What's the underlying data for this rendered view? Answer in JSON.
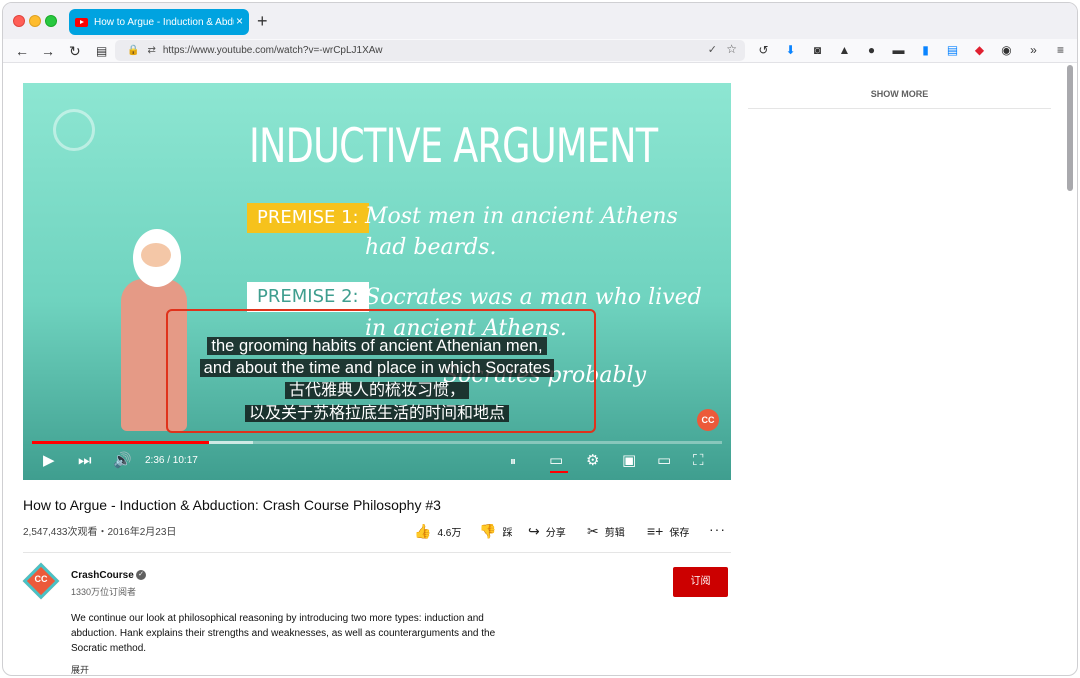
{
  "browser": {
    "tab_title": "How to Argue - Induction & Abdu",
    "tab_close": "×",
    "new_tab": "+",
    "url": "https://www.youtube.com/watch?v=-wrCpLJ1XAw",
    "nav_back": "←",
    "nav_forward": "→",
    "nav_reload": "↻",
    "nav_reader": "▤",
    "toolbar_icons": [
      "sync-icon",
      "download-icon",
      "screenshot-icon",
      "rocket-icon",
      "circle-icon",
      "container-icon",
      "bitwarden-icon",
      "save-icon",
      "pocket-icon",
      "panda-icon",
      "overflow-icon",
      "menu-icon"
    ],
    "accent_color": "#00a3e0"
  },
  "video": {
    "slide_title": "INDUCTIVE ARGUMENT",
    "premise1_label": "PREMISE 1:",
    "premise1_text_line1": "Most men in ancient Athens",
    "premise1_text_line2": "had beards.",
    "premise2_label": "PREMISE 2:",
    "premise2_text_line1": "Socrates was a man who lived",
    "premise2_text_line2": "in ancient Athens.",
    "premise3_text_partial": "Socrates probably",
    "cc_badge": "CC",
    "captions": [
      "the grooming habits of ancient Athenian men,",
      "and about the time and place in which Socrates",
      "古代雅典人的梳妆习惯，",
      "以及关于苏格拉底生活的时间和地点"
    ],
    "time": "2:36 / 10:17",
    "progress_played": 0.256,
    "progress_loaded": 0.32,
    "controls": {
      "play": "▶",
      "next": "⏭",
      "volume": "🔊",
      "autoplay": "⏸",
      "subtitles": "▭",
      "settings": "⚙",
      "miniplayer": "▣",
      "theater": "▭",
      "fullscreen": "⛶"
    }
  },
  "info": {
    "title": "How to Argue - Induction & Abduction: Crash Course Philosophy #3",
    "views": "2,547,433次观看・2016年2月23日",
    "like": "4.6万",
    "dislike": "踩",
    "share": "分享",
    "clip": "剪辑",
    "save": "保存",
    "more": "···"
  },
  "channel": {
    "avatar_text": "CC",
    "name": "CrashCourse",
    "verified": "✓",
    "subscribers": "1330万位订阅者",
    "subscribe": "订阅",
    "description": "We continue our look at philosophical reasoning by introducing two more types: induction and abduction. Hank explains their strengths and weaknesses, as well as counterarguments and the Socratic method.",
    "expand": "展开"
  },
  "sidebar": {
    "show_more": "SHOW MORE"
  }
}
